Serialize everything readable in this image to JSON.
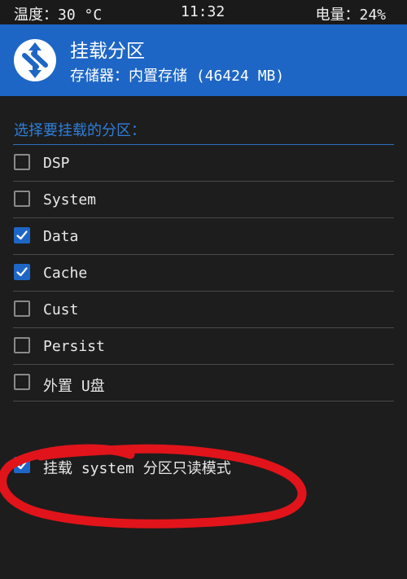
{
  "status_bar": {
    "temperature": "温度：30 °C",
    "time": "11:32",
    "battery": "电量：24%"
  },
  "header": {
    "logo_icon": "twrp-logo-icon",
    "title": "挂载分区",
    "subtitle": "存储器：内置存储 (46424 MB)"
  },
  "section": {
    "title": "选择要挂载的分区："
  },
  "partitions": [
    {
      "label": "DSP",
      "checked": false
    },
    {
      "label": "System",
      "checked": false
    },
    {
      "label": "Data",
      "checked": true
    },
    {
      "label": "Cache",
      "checked": true
    },
    {
      "label": "Cust",
      "checked": false
    },
    {
      "label": "Persist",
      "checked": false
    },
    {
      "label": "外置 U盘",
      "checked": false
    }
  ],
  "readonly_option": {
    "label": "挂载 system 分区只读模式",
    "checked": true
  },
  "colors": {
    "accent": "#1e66c5",
    "background": "#1d1d1d",
    "annotation": "#e0141a"
  }
}
